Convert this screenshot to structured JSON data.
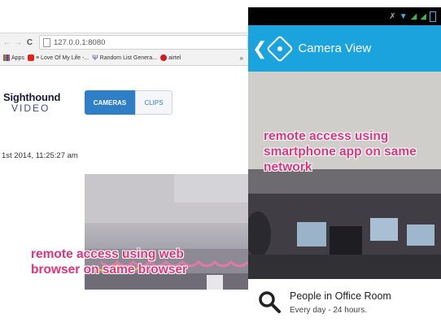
{
  "browser": {
    "url": "127.0.0.1:8080",
    "bookmarks": [
      "Apps",
      "≡ Love Of My Life -...",
      "Random List Genera...",
      "airtel"
    ],
    "more": "»"
  },
  "sighthound": {
    "logo_line1": "Sighthound",
    "logo_line2": "VIDEO",
    "tab_cameras": "CAMERAS",
    "tab_clips": "CLIPS",
    "timestamp": "1st 2014, 11:25:27 am"
  },
  "captions": {
    "left": "remote access using web browser on same browser",
    "right": "remote access using smartphone app on same network"
  },
  "phone": {
    "title": "Camera View",
    "camera_name": "People in Office Room",
    "schedule": "Every day - 24 hours."
  },
  "colors": {
    "action_bar": "#1ba3dd",
    "caption": "#e0337a",
    "tab_active": "#2f7fc7"
  }
}
